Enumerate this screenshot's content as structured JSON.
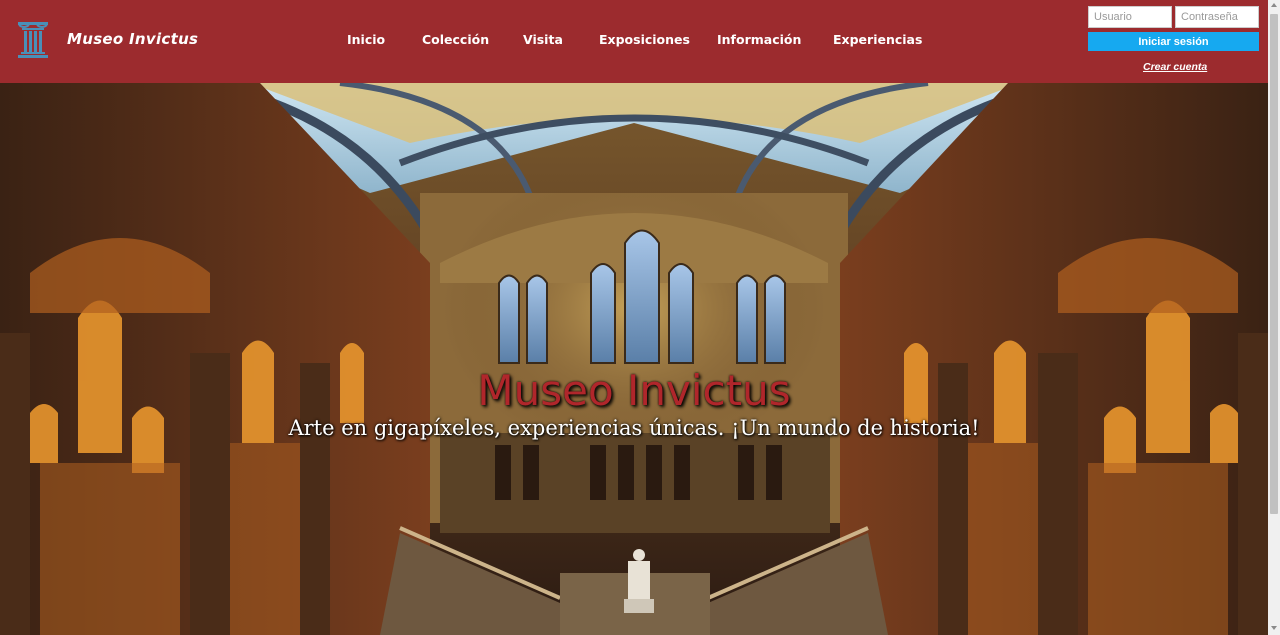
{
  "brand": {
    "name": "Museo Invictus"
  },
  "nav": [
    {
      "label": "Inicio"
    },
    {
      "label": "Colección"
    },
    {
      "label": "Visita"
    },
    {
      "label": "Exposiciones"
    },
    {
      "label": "Información"
    },
    {
      "label": "Experiencias"
    }
  ],
  "login": {
    "username_placeholder": "Usuario",
    "password_placeholder": "Contraseña",
    "submit_label": "Iniciar sesión",
    "create_account_label": "Crear cuenta"
  },
  "hero": {
    "title": "Museo Invictus",
    "subtitle": "Arte en gigapíxeles, experiencias únicas. ¡Un mundo de historia!"
  },
  "colors": {
    "header_bg": "#9c2b2e",
    "login_button": "#16a9f0",
    "hero_title": "#b0262b"
  },
  "icons": {
    "logo": "greek-column-icon"
  }
}
